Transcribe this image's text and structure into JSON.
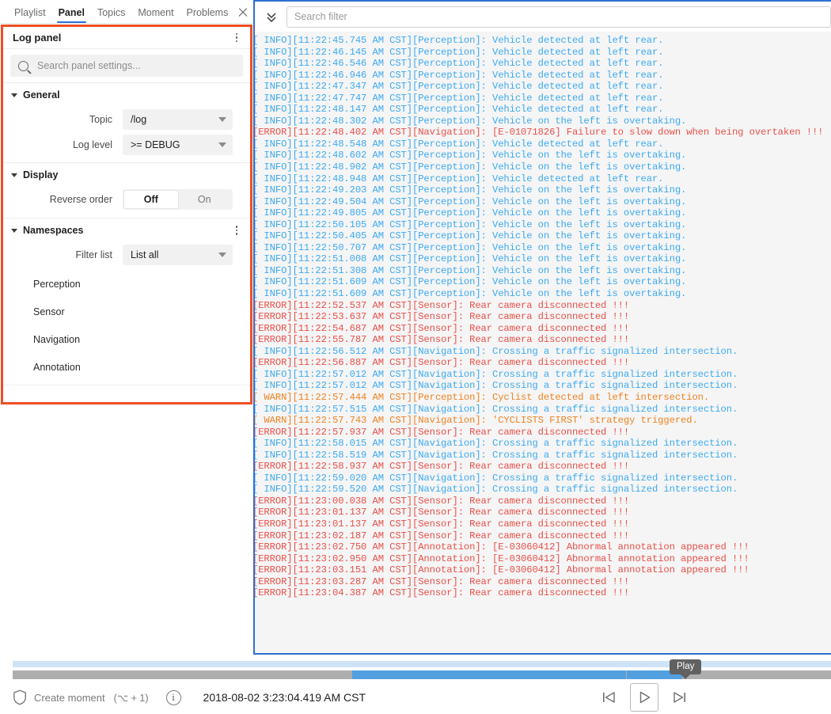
{
  "tabs": [
    {
      "label": "Playlist",
      "active": false
    },
    {
      "label": "Panel",
      "active": true
    },
    {
      "label": "Topics",
      "active": false
    },
    {
      "label": "Moment",
      "active": false
    },
    {
      "label": "Problems",
      "active": false
    }
  ],
  "settings_panel": {
    "title": "Log panel",
    "search_placeholder": "Search panel settings...",
    "search_value": "",
    "sections": {
      "general": {
        "label": "General",
        "topic_label": "Topic",
        "topic_value": "/log",
        "loglevel_label": "Log level",
        "loglevel_value": ">= DEBUG"
      },
      "display": {
        "label": "Display",
        "reverse_label": "Reverse order",
        "reverse_off": "Off",
        "reverse_on": "On",
        "reverse_selected": "Off"
      },
      "namespaces": {
        "label": "Namespaces",
        "filter_label": "Filter list",
        "filter_value": "List all",
        "items": [
          "Perception",
          "Sensor",
          "Navigation",
          "Annotation"
        ]
      }
    }
  },
  "log_panel": {
    "filter_placeholder": "Search filter",
    "filter_value": "",
    "colors": {
      "info": "#3daaf2",
      "warn": "#ef8322",
      "error": "#e8504a",
      "focus_border": "#2f6fd0",
      "highlight_border": "#f04e23"
    },
    "lines": [
      {
        "level": "INFO",
        "text": "[ INFO][11:22:45.745 AM CST][Perception]: Vehicle detected at left rear."
      },
      {
        "level": "INFO",
        "text": "[ INFO][11:22:46.145 AM CST][Perception]: Vehicle detected at left rear."
      },
      {
        "level": "INFO",
        "text": "[ INFO][11:22:46.546 AM CST][Perception]: Vehicle detected at left rear."
      },
      {
        "level": "INFO",
        "text": "[ INFO][11:22:46.946 AM CST][Perception]: Vehicle detected at left rear."
      },
      {
        "level": "INFO",
        "text": "[ INFO][11:22:47.347 AM CST][Perception]: Vehicle detected at left rear."
      },
      {
        "level": "INFO",
        "text": "[ INFO][11:22:47.747 AM CST][Perception]: Vehicle detected at left rear."
      },
      {
        "level": "INFO",
        "text": "[ INFO][11:22:48.147 AM CST][Perception]: Vehicle detected at left rear."
      },
      {
        "level": "INFO",
        "text": "[ INFO][11:22:48.302 AM CST][Perception]: Vehicle on the left is overtaking."
      },
      {
        "level": "ERROR",
        "text": "[ERROR][11:22:48.402 AM CST][Navigation]: [E-01071826] Failure to slow down when being overtaken !!!"
      },
      {
        "level": "INFO",
        "text": "[ INFO][11:22:48.548 AM CST][Perception]: Vehicle detected at left rear."
      },
      {
        "level": "INFO",
        "text": "[ INFO][11:22:48.602 AM CST][Perception]: Vehicle on the left is overtaking."
      },
      {
        "level": "INFO",
        "text": "[ INFO][11:22:48.902 AM CST][Perception]: Vehicle on the left is overtaking."
      },
      {
        "level": "INFO",
        "text": "[ INFO][11:22:48.948 AM CST][Perception]: Vehicle detected at left rear."
      },
      {
        "level": "INFO",
        "text": "[ INFO][11:22:49.203 AM CST][Perception]: Vehicle on the left is overtaking."
      },
      {
        "level": "INFO",
        "text": "[ INFO][11:22:49.504 AM CST][Perception]: Vehicle on the left is overtaking."
      },
      {
        "level": "INFO",
        "text": "[ INFO][11:22:49.805 AM CST][Perception]: Vehicle on the left is overtaking."
      },
      {
        "level": "INFO",
        "text": "[ INFO][11:22:50.105 AM CST][Perception]: Vehicle on the left is overtaking."
      },
      {
        "level": "INFO",
        "text": "[ INFO][11:22:50.405 AM CST][Perception]: Vehicle on the left is overtaking."
      },
      {
        "level": "INFO",
        "text": "[ INFO][11:22:50.707 AM CST][Perception]: Vehicle on the left is overtaking."
      },
      {
        "level": "INFO",
        "text": "[ INFO][11:22:51.008 AM CST][Perception]: Vehicle on the left is overtaking."
      },
      {
        "level": "INFO",
        "text": "[ INFO][11:22:51.308 AM CST][Perception]: Vehicle on the left is overtaking."
      },
      {
        "level": "INFO",
        "text": "[ INFO][11:22:51.609 AM CST][Perception]: Vehicle on the left is overtaking."
      },
      {
        "level": "INFO",
        "text": "[ INFO][11:22:51.609 AM CST][Perception]: Vehicle on the left is overtaking."
      },
      {
        "level": "ERROR",
        "text": "[ERROR][11:22:52.537 AM CST][Sensor]: Rear camera disconnected !!!"
      },
      {
        "level": "ERROR",
        "text": "[ERROR][11:22:53.637 AM CST][Sensor]: Rear camera disconnected !!!"
      },
      {
        "level": "ERROR",
        "text": "[ERROR][11:22:54.687 AM CST][Sensor]: Rear camera disconnected !!!"
      },
      {
        "level": "ERROR",
        "text": "[ERROR][11:22:55.787 AM CST][Sensor]: Rear camera disconnected !!!"
      },
      {
        "level": "INFO",
        "text": "[ INFO][11:22:56.512 AM CST][Navigation]: Crossing a traffic signalized intersection."
      },
      {
        "level": "ERROR",
        "text": "[ERROR][11:22:56.887 AM CST][Sensor]: Rear camera disconnected !!!"
      },
      {
        "level": "INFO",
        "text": "[ INFO][11:22:57.012 AM CST][Navigation]: Crossing a traffic signalized intersection."
      },
      {
        "level": "INFO",
        "text": "[ INFO][11:22:57.012 AM CST][Navigation]: Crossing a traffic signalized intersection."
      },
      {
        "level": "WARN",
        "text": "[ WARN][11:22:57.444 AM CST][Perception]: Cyclist detected at left intersection."
      },
      {
        "level": "INFO",
        "text": "[ INFO][11:22:57.515 AM CST][Navigation]: Crossing a traffic signalized intersection."
      },
      {
        "level": "WARN",
        "text": "[ WARN][11:22:57.743 AM CST][Navigation]: 'CYCLISTS FIRST' strategy triggered."
      },
      {
        "level": "ERROR",
        "text": "[ERROR][11:22:57.937 AM CST][Sensor]: Rear camera disconnected !!!"
      },
      {
        "level": "INFO",
        "text": "[ INFO][11:22:58.015 AM CST][Navigation]: Crossing a traffic signalized intersection."
      },
      {
        "level": "INFO",
        "text": "[ INFO][11:22:58.519 AM CST][Navigation]: Crossing a traffic signalized intersection."
      },
      {
        "level": "ERROR",
        "text": "[ERROR][11:22:58.937 AM CST][Sensor]: Rear camera disconnected !!!"
      },
      {
        "level": "INFO",
        "text": "[ INFO][11:22:59.020 AM CST][Navigation]: Crossing a traffic signalized intersection."
      },
      {
        "level": "INFO",
        "text": "[ INFO][11:22:59.520 AM CST][Navigation]: Crossing a traffic signalized intersection."
      },
      {
        "level": "ERROR",
        "text": "[ERROR][11:23:00.038 AM CST][Sensor]: Rear camera disconnected !!!"
      },
      {
        "level": "ERROR",
        "text": "[ERROR][11:23:01.137 AM CST][Sensor]: Rear camera disconnected !!!"
      },
      {
        "level": "ERROR",
        "text": "[ERROR][11:23:01.137 AM CST][Sensor]: Rear camera disconnected !!!"
      },
      {
        "level": "ERROR",
        "text": "[ERROR][11:23:02.187 AM CST][Sensor]: Rear camera disconnected !!!"
      },
      {
        "level": "ERROR",
        "text": "[ERROR][11:23:02.750 AM CST][Annotation]: [E-03060412] Abnormal annotation appeared !!!"
      },
      {
        "level": "ERROR",
        "text": "[ERROR][11:23:02.950 AM CST][Annotation]: [E-03060412] Abnormal annotation appeared !!!"
      },
      {
        "level": "ERROR",
        "text": "[ERROR][11:23:03.151 AM CST][Annotation]: [E-03060412] Abnormal annotation appeared !!!"
      },
      {
        "level": "ERROR",
        "text": "[ERROR][11:23:03.287 AM CST][Sensor]: Rear camera disconnected !!!"
      },
      {
        "level": "ERROR",
        "text": "[ERROR][11:23:04.387 AM CST][Sensor]: Rear camera disconnected !!!"
      }
    ]
  },
  "timeline": {
    "cache_fill_pct": 100,
    "segments": [
      {
        "start_pct": 41.5,
        "end_pct": 75.0
      },
      {
        "start_pct": 97.0,
        "end_pct": 97.0
      }
    ],
    "playhead_pct": 81.8,
    "play_tooltip": "Play"
  },
  "bottom_bar": {
    "create_moment_label": "Create moment",
    "create_moment_shortcut": "(⌥ + 1)",
    "info_glyph": "i",
    "timestamp": "2018-08-02 3:23:04.419 AM CST",
    "transport": {
      "prev": "seek-backward",
      "play": "play",
      "next": "seek-forward"
    }
  }
}
